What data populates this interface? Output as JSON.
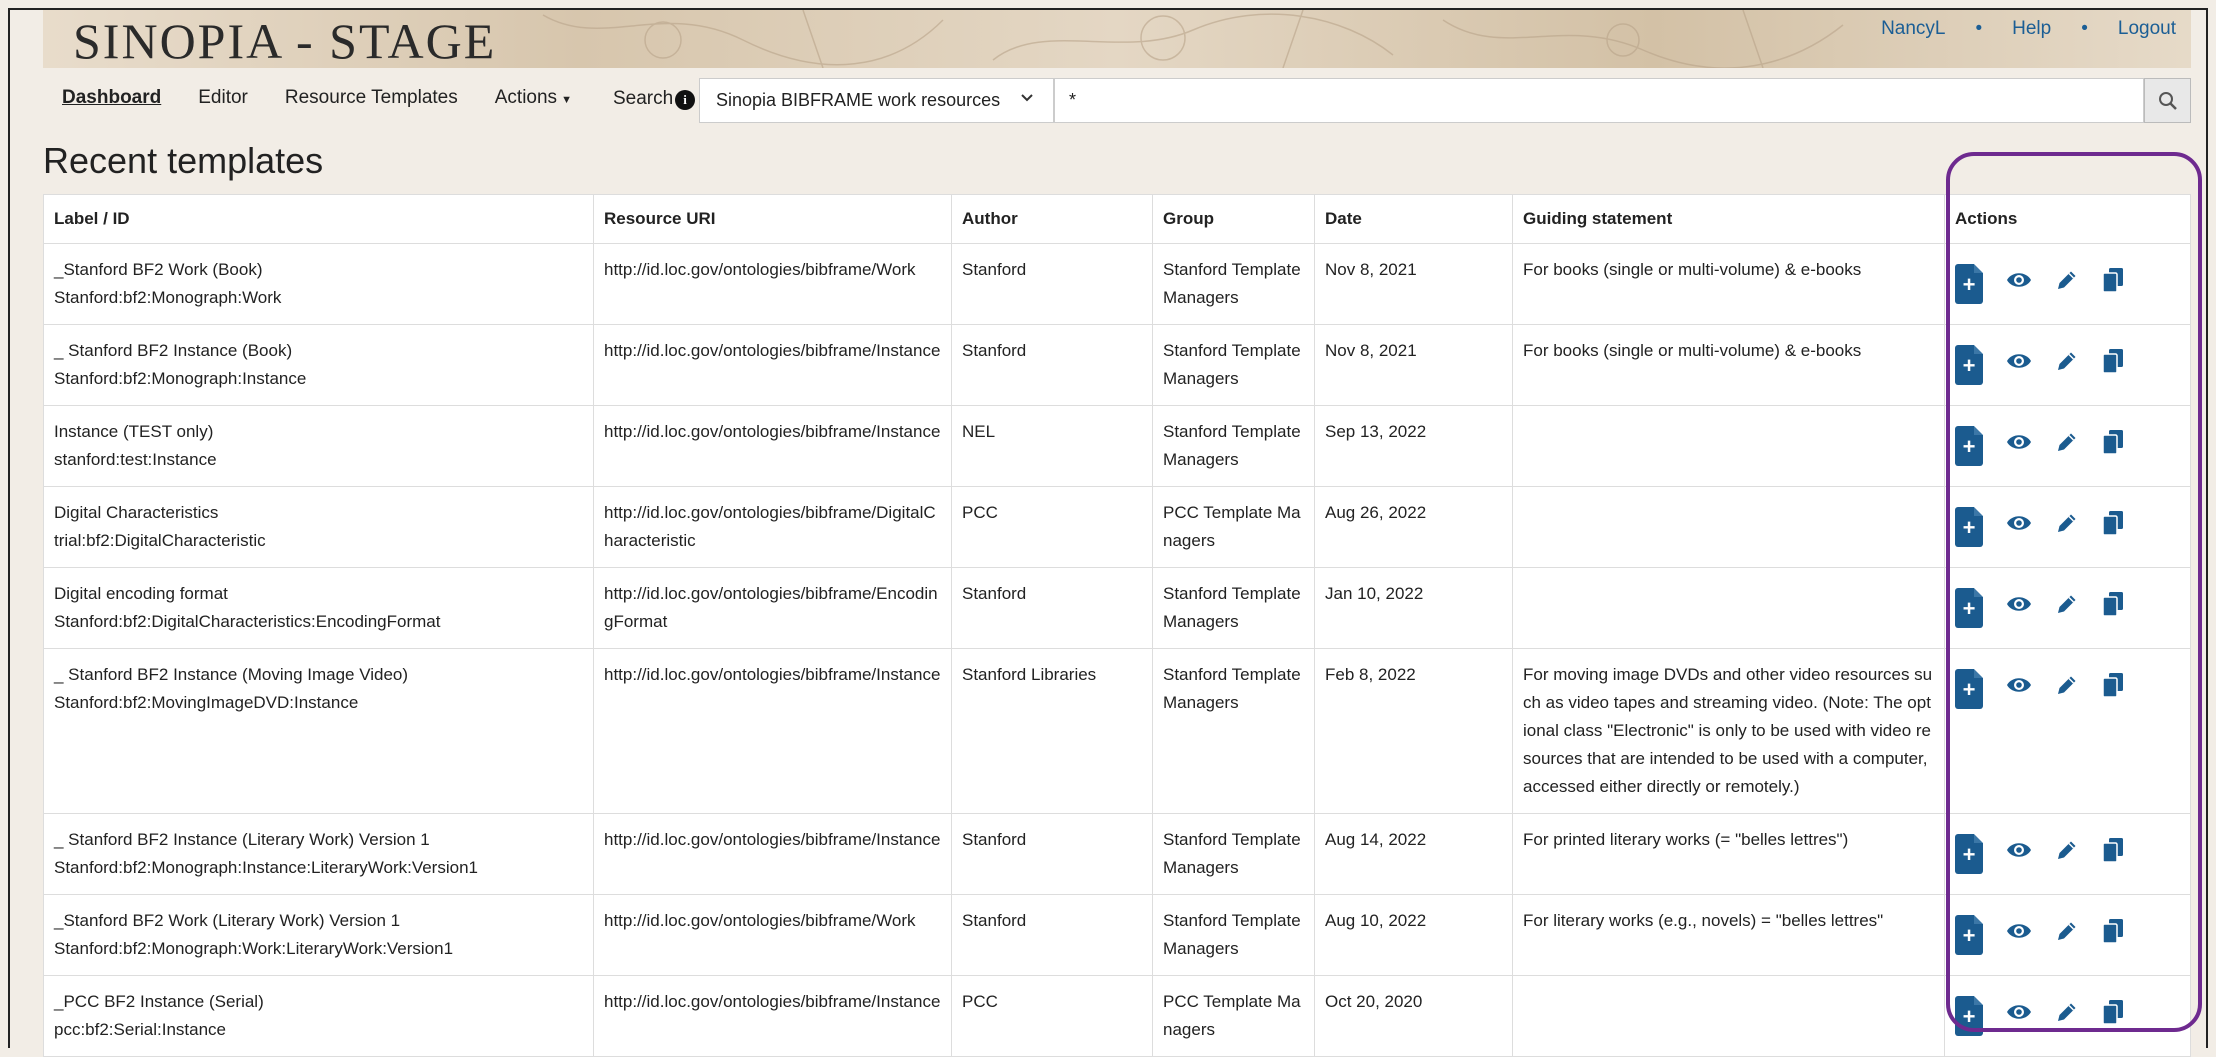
{
  "header": {
    "brand": "SINOPIA - STAGE",
    "user_links": [
      "NancyL",
      "Help",
      "Logout"
    ],
    "separator": "•"
  },
  "nav": {
    "items": [
      "Dashboard",
      "Editor",
      "Resource Templates",
      "Actions"
    ],
    "active": "Dashboard"
  },
  "search": {
    "label": "Search",
    "info_icon": "info-icon",
    "selected_source": "Sinopia BIBFRAME work resources",
    "query": "*",
    "button_icon": "search-icon"
  },
  "page_title": "Recent templates",
  "table": {
    "headers": [
      "Label / ID",
      "Resource URI",
      "Author",
      "Group",
      "Date",
      "Guiding statement",
      "Actions"
    ],
    "rows": [
      {
        "label": "_Stanford BF2 Work (Book)",
        "id": "Stanford:bf2:Monograph:Work",
        "uri": "http://id.loc.gov/ontologies/bibframe/Work",
        "author": "Stanford",
        "group": "Stanford Template Managers",
        "date": "Nov 8, 2021",
        "guide": "For books (single or multi-volume) & e-books"
      },
      {
        "label": "_ Stanford BF2 Instance (Book)",
        "id": "Stanford:bf2:Monograph:Instance",
        "uri": "http://id.loc.gov/ontologies/bibframe/Instance",
        "author": "Stanford",
        "group": "Stanford Template Managers",
        "date": "Nov 8, 2021",
        "guide": "For books (single or multi-volume) & e-books"
      },
      {
        "label": "Instance (TEST only)",
        "id": "stanford:test:Instance",
        "uri": "http://id.loc.gov/ontologies/bibframe/Instance",
        "author": "NEL",
        "group": "Stanford Template Managers",
        "date": "Sep 13, 2022",
        "guide": ""
      },
      {
        "label": "Digital Characteristics",
        "id": "trial:bf2:DigitalCharacteristic",
        "uri": "http://id.loc.gov/ontologies/bibframe/DigitalCharacteristic",
        "author": "PCC",
        "group": "PCC Template Managers",
        "date": "Aug 26, 2022",
        "guide": ""
      },
      {
        "label": "Digital encoding format",
        "id": "Stanford:bf2:DigitalCharacteristics:EncodingFormat",
        "uri": "http://id.loc.gov/ontologies/bibframe/EncodingFormat",
        "author": "Stanford",
        "group": "Stanford Template Managers",
        "date": "Jan 10, 2022",
        "guide": ""
      },
      {
        "label": "_ Stanford BF2 Instance (Moving Image Video)",
        "id": "Stanford:bf2:MovingImageDVD:Instance",
        "uri": "http://id.loc.gov/ontologies/bibframe/Instance",
        "author": "Stanford Libraries",
        "group": "Stanford Template Managers",
        "date": "Feb 8, 2022",
        "guide": "For moving image DVDs and other video resources such as video tapes and streaming video. (Note: The optional class \"Electronic\" is only to be used with video resources that are intended to be used with a computer, accessed either directly or remotely.)"
      },
      {
        "label": "_ Stanford BF2 Instance (Literary Work) Version 1",
        "id": "Stanford:bf2:Monograph:Instance:LiteraryWork:Version1",
        "uri": "http://id.loc.gov/ontologies/bibframe/Instance",
        "author": "Stanford",
        "group": "Stanford Template Managers",
        "date": "Aug 14, 2022",
        "guide": "For printed literary works (= \"belles lettres\")"
      },
      {
        "label": "_Stanford BF2 Work (Literary Work) Version 1",
        "id": "Stanford:bf2:Monograph:Work:LiteraryWork:Version1",
        "uri": "http://id.loc.gov/ontologies/bibframe/Work",
        "author": "Stanford",
        "group": "Stanford Template Managers",
        "date": "Aug 10, 2022",
        "guide": "For literary works (e.g., novels) = \"belles lettres\""
      },
      {
        "label": "_PCC BF2 Instance (Serial)",
        "id": "pcc:bf2:Serial:Instance",
        "uri": "http://id.loc.gov/ontologies/bibframe/Instance",
        "author": "PCC",
        "group": "PCC Template Managers",
        "date": "Oct 20, 2020",
        "guide": ""
      }
    ],
    "action_icons": [
      "new-resource-icon",
      "view-icon",
      "edit-icon",
      "copy-icon"
    ],
    "new_symbol": "+"
  },
  "colors": {
    "accent": "#1b5b8f",
    "highlight": "#6e2a8f",
    "link": "#1b5e95"
  }
}
